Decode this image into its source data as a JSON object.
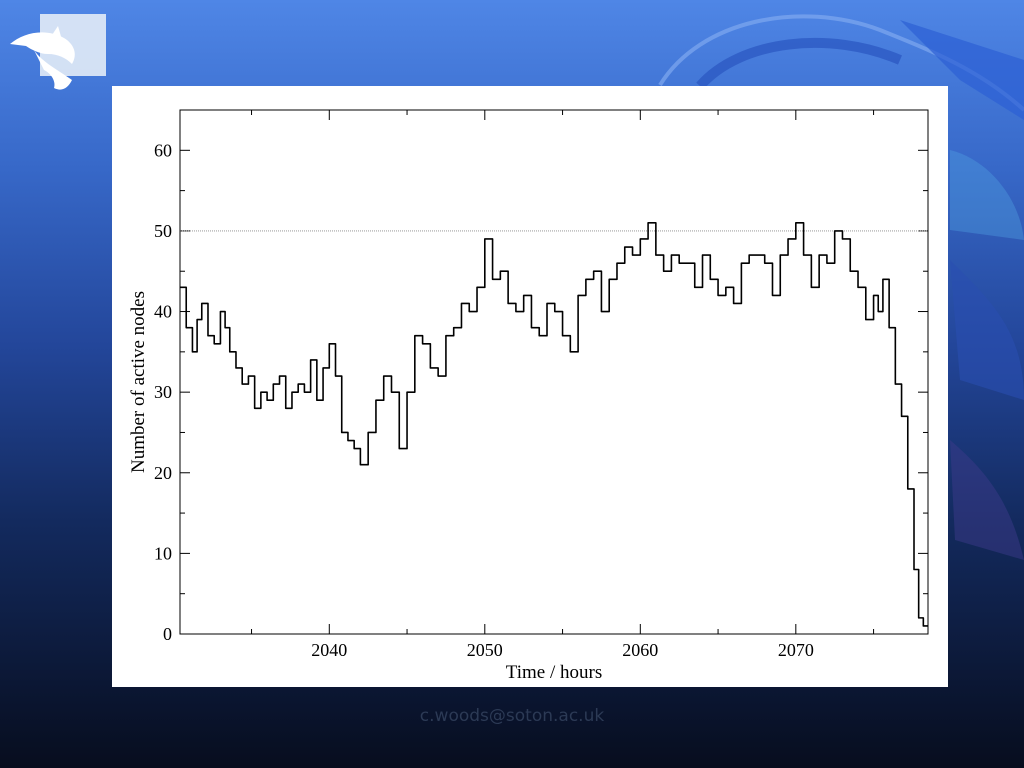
{
  "footer": {
    "email": "c.woods@soton.ac.uk"
  },
  "logo": {
    "icon": "dolphin-logo-icon"
  },
  "colors": {
    "background_top": "#4f86e6",
    "background_bottom": "#070d1e",
    "line": "#000000",
    "reference_line": "#888888"
  },
  "chart_data": {
    "type": "line",
    "title": "",
    "xlabel": "Time / hours",
    "ylabel": "Number of active nodes",
    "xlim": [
      2030.4,
      2078.5
    ],
    "ylim": [
      0,
      65
    ],
    "x_ticks": [
      2040,
      2050,
      2060,
      2070
    ],
    "y_ticks": [
      0,
      10,
      20,
      30,
      40,
      50,
      60
    ],
    "reference_line_y": 50,
    "grid": false,
    "series": [
      {
        "x": [
          2030.4,
          2030.8,
          2031.2,
          2031.5,
          2031.8,
          2032.2,
          2032.6,
          2033.0,
          2033.3,
          2033.6,
          2034.0,
          2034.4,
          2034.8,
          2035.2,
          2035.6,
          2036.0,
          2036.4,
          2036.8,
          2037.2,
          2037.6,
          2038.0,
          2038.4,
          2038.8,
          2039.2,
          2039.6,
          2040.0,
          2040.4,
          2040.8,
          2041.2,
          2041.6,
          2042.0,
          2042.5,
          2043.0,
          2043.5,
          2044.0,
          2044.5,
          2045.0,
          2045.5,
          2046.0,
          2046.5,
          2047.0,
          2047.5,
          2048.0,
          2048.5,
          2049.0,
          2049.5,
          2050.0,
          2050.5,
          2051.0,
          2051.5,
          2052.0,
          2052.5,
          2053.0,
          2053.5,
          2054.0,
          2054.5,
          2055.0,
          2055.5,
          2056.0,
          2056.5,
          2057.0,
          2057.5,
          2058.0,
          2058.5,
          2059.0,
          2059.5,
          2060.0,
          2060.5,
          2061.0,
          2061.5,
          2062.0,
          2062.5,
          2063.0,
          2063.5,
          2064.0,
          2064.5,
          2065.0,
          2065.5,
          2066.0,
          2066.5,
          2067.0,
          2067.5,
          2068.0,
          2068.5,
          2069.0,
          2069.5,
          2070.0,
          2070.5,
          2071.0,
          2071.5,
          2072.0,
          2072.5,
          2073.0,
          2073.5,
          2074.0,
          2074.5,
          2075.0,
          2075.3,
          2075.6,
          2076.0,
          2076.4,
          2076.8,
          2077.2,
          2077.6,
          2077.9,
          2078.2,
          2078.5
        ],
        "y": [
          43,
          38,
          35,
          39,
          41,
          37,
          36,
          40,
          38,
          35,
          33,
          31,
          32,
          28,
          30,
          29,
          31,
          32,
          28,
          30,
          31,
          30,
          34,
          29,
          33,
          36,
          32,
          25,
          24,
          23,
          21,
          25,
          29,
          32,
          30,
          23,
          30,
          37,
          36,
          33,
          32,
          37,
          38,
          41,
          40,
          43,
          49,
          44,
          45,
          41,
          40,
          42,
          38,
          37,
          41,
          40,
          37,
          35,
          42,
          44,
          45,
          40,
          44,
          46,
          48,
          47,
          49,
          51,
          47,
          45,
          47,
          46,
          46,
          43,
          47,
          44,
          42,
          43,
          41,
          46,
          47,
          47,
          46,
          42,
          47,
          49,
          51,
          47,
          43,
          47,
          46,
          50,
          49,
          45,
          43,
          39,
          42,
          40,
          44,
          38,
          31,
          27,
          18,
          8,
          2,
          1,
          1
        ]
      }
    ]
  }
}
